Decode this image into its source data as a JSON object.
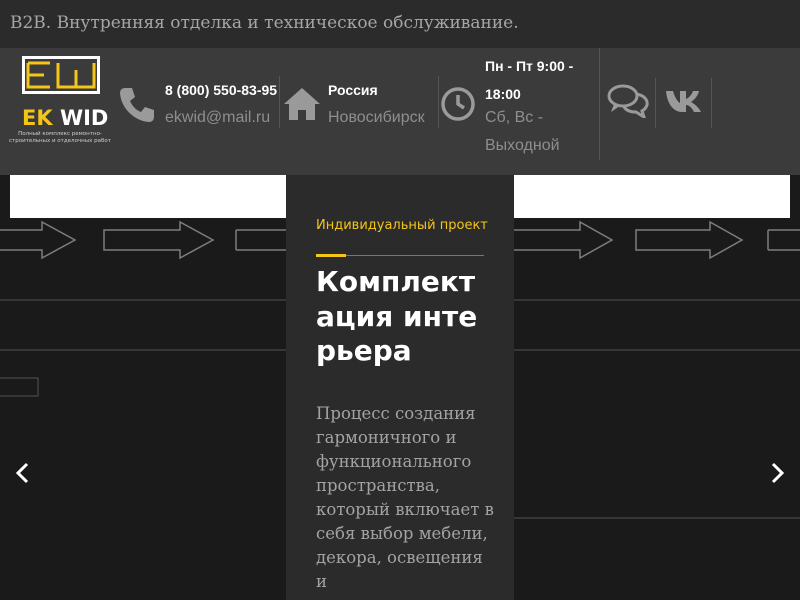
{
  "topbar": {
    "text": "B2B. Внутренняя отделка и техническое обслуживание."
  },
  "logo": {
    "name_part1": "EK",
    "name_part2": "WID",
    "tagline": "Полный комплекс ремонтно-строительных и отделочных работ"
  },
  "contacts": {
    "phone": "8 (800) 550-83-95",
    "email": "ekwid@mail.ru",
    "country": "Россия",
    "city": "Новосибирск",
    "hours_weekdays": "Пн - Пт 9:00 - 18:00",
    "hours_weekend": "Сб, Вс - Выходной"
  },
  "icons": {
    "phone": "phone-icon",
    "home": "home-icon",
    "clock": "clock-icon",
    "chat": "chat-icon",
    "vk": "vk-icon",
    "menu": "hamburger-menu-icon",
    "prev": "chevron-left-icon",
    "next": "chevron-right-icon"
  },
  "slide": {
    "subtitle": "Индивидуальный проект",
    "title": "Комплектация интерьера",
    "description": "Процесс создания гармоничного и функционального пространства, который включает в себя выбор мебели, декора, освещения и"
  },
  "colors": {
    "accent": "#f5c518",
    "topbar_bg": "#2b2b2b",
    "header_bg": "#3b3b3b",
    "hero_bg": "#1a1a1a",
    "card_bg": "#2b2b2b"
  }
}
